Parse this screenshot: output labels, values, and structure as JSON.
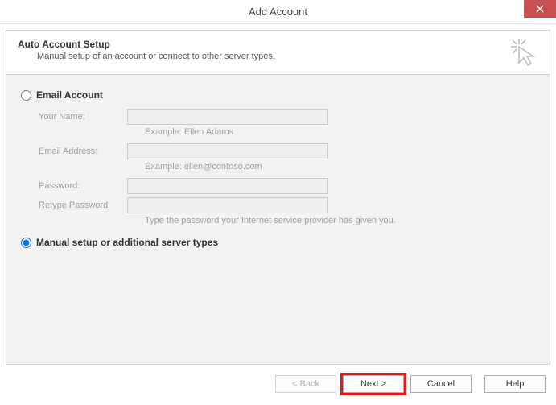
{
  "window": {
    "title": "Add Account"
  },
  "header": {
    "title": "Auto Account Setup",
    "subtitle": "Manual setup of an account or connect to other server types."
  },
  "options": {
    "email_account_label": "Email Account",
    "manual_setup_label": "Manual setup or additional server types"
  },
  "fields": {
    "your_name": {
      "label": "Your Name:",
      "value": "",
      "hint": "Example: Ellen Adams"
    },
    "email": {
      "label": "Email Address:",
      "value": "",
      "hint": "Example: ellen@contoso.com"
    },
    "password": {
      "label": "Password:",
      "value": ""
    },
    "retype_password": {
      "label": "Retype Password:",
      "value": "",
      "hint": "Type the password your Internet service provider has given you."
    }
  },
  "buttons": {
    "back": "< Back",
    "next": "Next >",
    "cancel": "Cancel",
    "help": "Help"
  }
}
